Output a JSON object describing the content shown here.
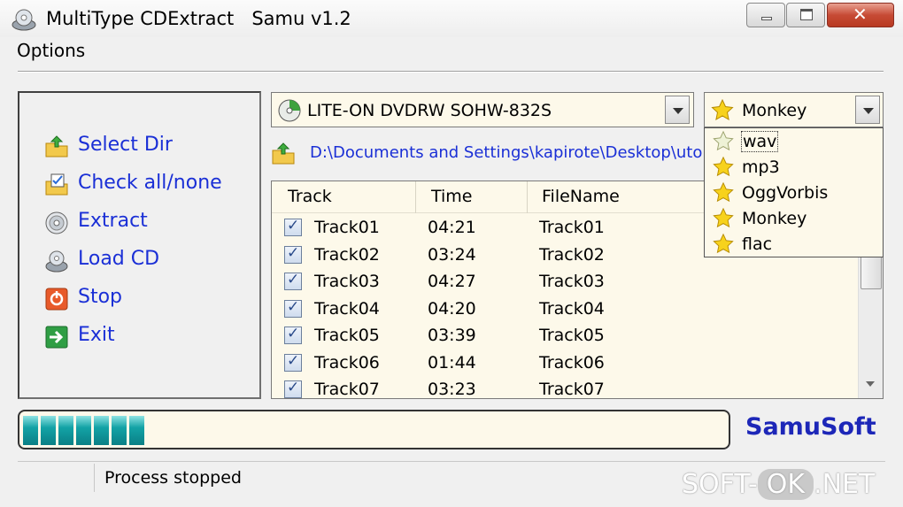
{
  "window": {
    "title": "MultiType CDExtract   Samu v1.2",
    "close_glyph": "✕"
  },
  "menu": {
    "options": "Options"
  },
  "actions": [
    {
      "label": "Select Dir",
      "icon": "folder-arrow-icon"
    },
    {
      "label": "Check all/none",
      "icon": "folder-check-icon"
    },
    {
      "label": "Extract",
      "icon": "disc-icon"
    },
    {
      "label": "Load CD",
      "icon": "cd-drive-icon"
    },
    {
      "label": "Stop",
      "icon": "stop-icon"
    },
    {
      "label": "Exit",
      "icon": "exit-arrow-icon"
    }
  ],
  "drive": {
    "selected": "LITE-ON DVDRW SOHW-832S"
  },
  "format": {
    "selected": "Monkey",
    "options": [
      "wav",
      "mp3",
      "OggVorbis",
      "Monkey",
      "flac"
    ],
    "highlighted": "wav"
  },
  "path": {
    "value": "D:\\Documents and Settings\\kapirote\\Desktop\\utorrent"
  },
  "track_list": {
    "columns": [
      "Track",
      "Time",
      "FileName"
    ],
    "rows": [
      {
        "checked": true,
        "track": "Track01",
        "time": "04:21",
        "filename": "Track01"
      },
      {
        "checked": true,
        "track": "Track02",
        "time": "03:24",
        "filename": "Track02"
      },
      {
        "checked": true,
        "track": "Track03",
        "time": "04:27",
        "filename": "Track03"
      },
      {
        "checked": true,
        "track": "Track04",
        "time": "04:20",
        "filename": "Track04"
      },
      {
        "checked": true,
        "track": "Track05",
        "time": "03:39",
        "filename": "Track05"
      },
      {
        "checked": true,
        "track": "Track06",
        "time": "01:44",
        "filename": "Track06"
      },
      {
        "checked": true,
        "track": "Track07",
        "time": "03:23",
        "filename": "Track07"
      }
    ],
    "check_glyph": "✓"
  },
  "progress": {
    "segments_filled": 7
  },
  "brand": "SamuSoft",
  "status": {
    "text": "Process stopped"
  },
  "watermark": {
    "left": "SOFT-",
    "ok": "OK",
    "right": ".NET"
  }
}
